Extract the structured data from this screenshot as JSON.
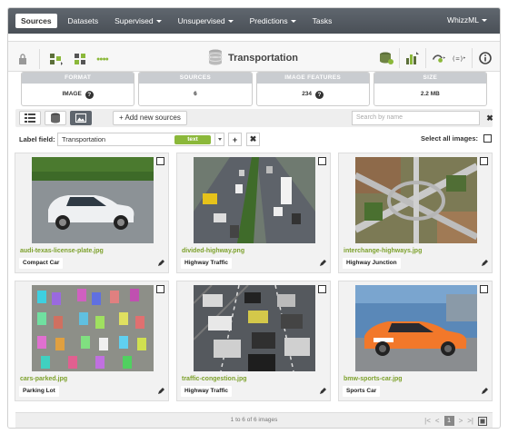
{
  "nav": {
    "items": [
      {
        "label": "Sources",
        "active": true,
        "dropdown": false
      },
      {
        "label": "Datasets",
        "active": false,
        "dropdown": false
      },
      {
        "label": "Supervised",
        "active": false,
        "dropdown": true
      },
      {
        "label": "Unsupervised",
        "active": false,
        "dropdown": true
      },
      {
        "label": "Predictions",
        "active": false,
        "dropdown": true
      },
      {
        "label": "Tasks",
        "active": false,
        "dropdown": false
      }
    ],
    "user": "WhizzML",
    "user_dropdown": true
  },
  "toolbar": {
    "title": "Transportation",
    "title_icon": "database-icon",
    "status_dots": "●●●●",
    "left_icons": [
      "lock-icon",
      "config-source-icon",
      "composite-icon"
    ],
    "right_icons": [
      "dataset-icon",
      "chart-icon",
      "model-icon",
      "formula-icon",
      "info-icon"
    ]
  },
  "stats": [
    {
      "header": "FORMAT",
      "value": "IMAGE",
      "help": true
    },
    {
      "header": "SOURCES",
      "value": "6",
      "help": false
    },
    {
      "header": "IMAGE FEATURES",
      "value": "234",
      "help": true
    },
    {
      "header": "SIZE",
      "value": "2.2 MB",
      "help": false
    }
  ],
  "viewbar": {
    "views": [
      "list-view-icon",
      "table-view-icon",
      "image-view-icon"
    ],
    "active_view": 2,
    "add_label": "+ Add new sources",
    "search_placeholder": "Search by name",
    "clear": "✖"
  },
  "label_field": {
    "label": "Label field:",
    "value": "Transportation",
    "type_tag": "text",
    "add": "+",
    "remove": "✖",
    "select_all": "Select all images:"
  },
  "cards": [
    {
      "file": "audi-texas-license-plate.jpg",
      "label": "Compact Car"
    },
    {
      "file": "divided-highway.png",
      "label": "Highway Traffic"
    },
    {
      "file": "interchange-highways.jpg",
      "label": "Highway Junction"
    },
    {
      "file": "cars-parked.jpg",
      "label": "Parking Lot"
    },
    {
      "file": "traffic-congestion.jpg",
      "label": "Highway Traffic"
    },
    {
      "file": "bmw-sports-car.jpg",
      "label": "Sports Car"
    }
  ],
  "footer": {
    "info": "1 to 6 of 6 images",
    "current_page": "1"
  },
  "colors": {
    "nav_bg": "#555b62",
    "accent_green": "#8bb83a",
    "filename_green": "#7da12c",
    "stat_header": "#c9ccd0"
  }
}
